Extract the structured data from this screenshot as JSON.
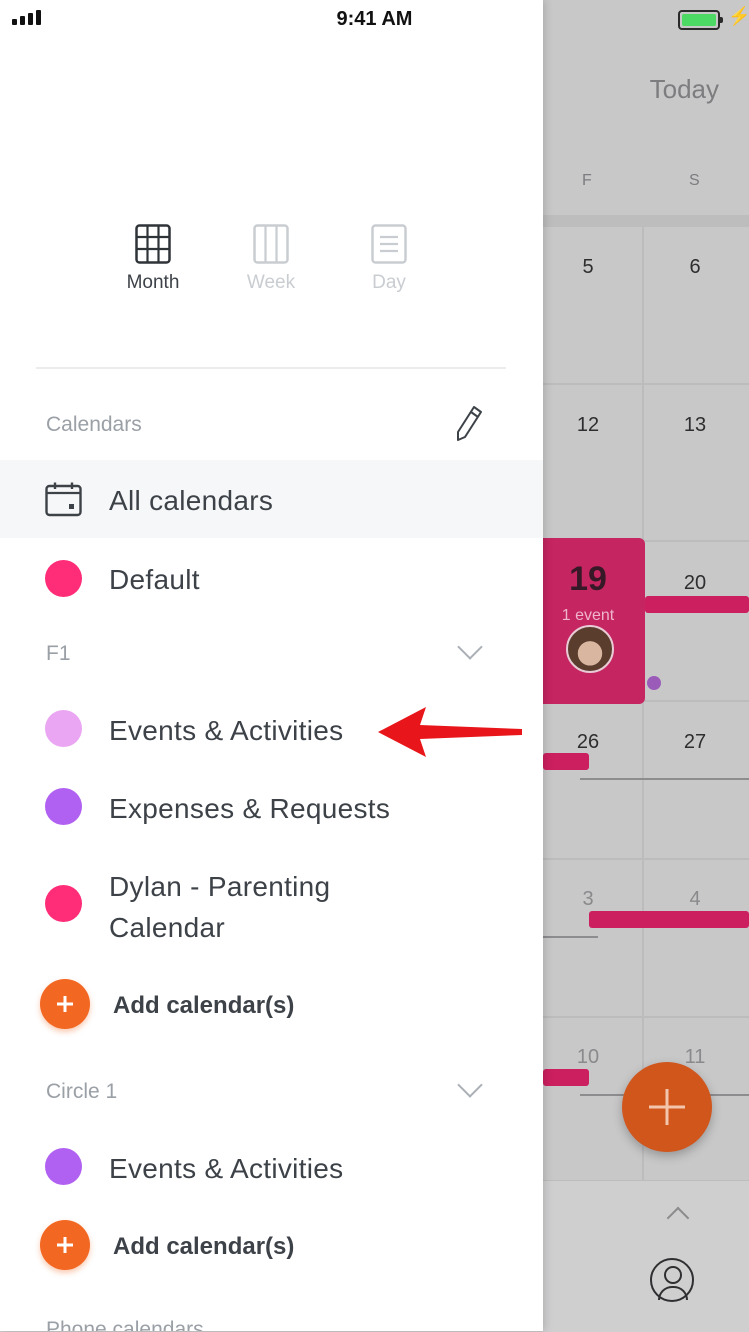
{
  "status_bar": {
    "time": "9:41 AM"
  },
  "background_calendar": {
    "today_label": "Today",
    "weekday_headers": [
      "F",
      "S"
    ],
    "weeks": [
      {
        "f": "5",
        "s": "6"
      },
      {
        "f": "12",
        "s": "13"
      },
      {
        "f": "19",
        "s": "20"
      },
      {
        "f": "26",
        "s": "27"
      },
      {
        "f": "3",
        "s": "4"
      },
      {
        "f": "10",
        "s": "11"
      }
    ],
    "selected_day_events": "1 event",
    "bottom_fragment": ")"
  },
  "drawer": {
    "view_options": [
      {
        "label": "Month",
        "icon": "month-grid-icon",
        "active": true
      },
      {
        "label": "Week",
        "icon": "week-columns-icon",
        "active": false
      },
      {
        "label": "Day",
        "icon": "day-list-icon",
        "active": false
      }
    ],
    "calendars_header": "Calendars",
    "all_calendars": "All calendars",
    "default_calendar": {
      "label": "Default",
      "color": "#ff2d78"
    },
    "groups": [
      {
        "name": "F1",
        "calendars": [
          {
            "label": "Events & Activities",
            "color": "#eaa6f2"
          },
          {
            "label": "Expenses & Requests",
            "color": "#b061f2"
          },
          {
            "label": "Dylan - Parenting",
            "label_line2": "Calendar",
            "color": "#ff2d78"
          }
        ],
        "add_label": "Add calendar(s)"
      },
      {
        "name": "Circle 1",
        "calendars": [
          {
            "label": "Events & Activities",
            "color": "#b061f2"
          }
        ],
        "add_label": "Add calendar(s)"
      }
    ],
    "next_section": "Phone calendars"
  },
  "colors": {
    "accent_orange": "#f26722",
    "event_pink": "#cc1f5f",
    "annotation_arrow": "#e8161b"
  }
}
